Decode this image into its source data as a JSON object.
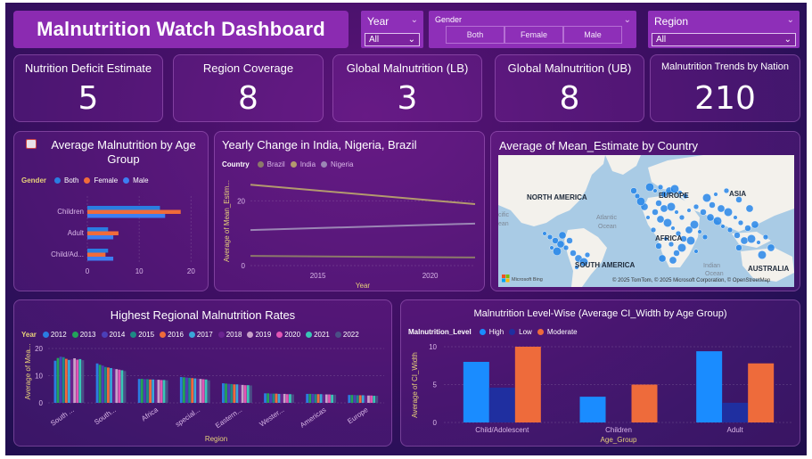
{
  "header": {
    "title": "Malnutrition Watch Dashboard"
  },
  "slicers": {
    "year": {
      "label": "Year",
      "value": "All"
    },
    "gender": {
      "label": "Gender",
      "options": [
        "Both",
        "Female",
        "Male"
      ]
    },
    "region": {
      "label": "Region",
      "value": "All"
    }
  },
  "kpis": [
    {
      "title": "Nutrition Deficit Estimate",
      "value": "5"
    },
    {
      "title": "Region Coverage",
      "value": "8"
    },
    {
      "title": "Global Malnutrition (LB)",
      "value": "3"
    },
    {
      "title": "Global Malnutrition (UB)",
      "value": "8"
    },
    {
      "title": "Malnutrition Trends by Nation",
      "value": "210"
    }
  ],
  "colors": {
    "both": "#2a7de1",
    "female": "#f06b3a",
    "male": "#3d7ef2",
    "high": "#1a8cff",
    "low": "#1f2fa0",
    "moderate": "#ee6b3b",
    "brazil": "#8c7a6a",
    "india": "#b39a6e",
    "nigeria": "#9b86b5"
  },
  "age_chart": {
    "icon": "chart-emoji-icon",
    "title": "Average Malnutrition by Age Group",
    "legend_title": "Gender",
    "legend": [
      "Both",
      "Female",
      "Male"
    ],
    "chart_data": {
      "type": "bar",
      "orientation": "horizontal",
      "categories": [
        "Children",
        "Adult",
        "Child/Ad..."
      ],
      "series": [
        {
          "name": "Both",
          "values": [
            14,
            4,
            4
          ]
        },
        {
          "name": "Female",
          "values": [
            18,
            6,
            3.5
          ]
        },
        {
          "name": "Male",
          "values": [
            15,
            5,
            5
          ]
        }
      ],
      "x_ticks": [
        "0",
        "10",
        "20"
      ],
      "xlim": [
        0,
        22
      ],
      "legend_placement": "top-left"
    }
  },
  "yearly_chart": {
    "title": "Yearly Change in India, Nigeria, Brazil",
    "legend_title": "Country",
    "legend": [
      "Brazil",
      "India",
      "Nigeria"
    ],
    "chart_data": {
      "type": "line",
      "x": [
        2012,
        2022
      ],
      "series": [
        {
          "name": "India",
          "values": [
            25,
            19
          ]
        },
        {
          "name": "Nigeria",
          "values": [
            11,
            13
          ]
        },
        {
          "name": "Brazil",
          "values": [
            3,
            2.5
          ]
        }
      ],
      "x_ticks": [
        "2015",
        "2020"
      ],
      "y_ticks": [
        "0",
        "20"
      ],
      "ylim": [
        0,
        27
      ],
      "xlim": [
        2012,
        2022
      ],
      "xlabel": "Year",
      "ylabel": "Average of Mean_Estim..."
    }
  },
  "map_chart": {
    "title": "Average of Mean_Estimate by Country",
    "labels": {
      "north_america": "NORTH AMERICA",
      "south_america": "SOUTH AMERICA",
      "europe": "EUROPE",
      "asia": "ASIA",
      "africa": "AFRICA",
      "australia": "AUSTRALIA",
      "atlantic": "Atlantic",
      "ocean1": "Ocean",
      "indian": "Indian",
      "ocean2": "Ocean",
      "pacific": "cific",
      "ocean3": "ean"
    },
    "logo": "Microsoft Bing",
    "credit": "© 2025 TomTom, © 2025 Microsoft Corporation, © OpenStreetMap"
  },
  "regional_chart": {
    "title": "Highest Regional Malnutrition Rates",
    "legend_title": "Year",
    "legend": [
      "2012",
      "2013",
      "2014",
      "2015",
      "2016",
      "2017",
      "2018",
      "2019",
      "2020",
      "2021",
      "2022"
    ],
    "legend_colors": [
      "#2a7de1",
      "#22a35a",
      "#4b3fb8",
      "#1d8a84",
      "#f06b3a",
      "#3aa6d8",
      "#6a2390",
      "#c7a0c9",
      "#e255b4",
      "#39c6b6",
      "#4a4f86"
    ],
    "chart_data": {
      "type": "bar",
      "categories": [
        "South ...",
        "South...",
        "Africa",
        "special...",
        "Eastern...",
        "Wester...",
        "Americas",
        "Europe"
      ],
      "series_note": "Each category shows grouped bars per year",
      "values": [
        [
          15.5,
          16.5,
          17,
          16.8,
          16.2,
          15.8,
          16,
          16.4,
          15.9,
          16.1,
          15.7
        ],
        [
          14.5,
          14,
          13.7,
          13.2,
          13,
          12.8,
          12.6,
          12.4,
          12.2,
          12,
          11.7
        ],
        [
          8.8,
          8.8,
          8.7,
          8.7,
          8.6,
          8.6,
          8.5,
          8.5,
          8.4,
          8.4,
          8.3
        ],
        [
          9.5,
          9.4,
          9.3,
          9.2,
          9.1,
          9.0,
          8.9,
          8.8,
          8.7,
          8.6,
          8.3
        ],
        [
          7.2,
          7.1,
          7.0,
          6.9,
          6.8,
          6.8,
          6.7,
          6.6,
          6.5,
          6.5,
          6.4
        ],
        [
          3.5,
          3.5,
          3.4,
          3.4,
          3.4,
          3.3,
          3.3,
          3.3,
          3.2,
          3.2,
          3.1
        ],
        [
          3.3,
          3.3,
          3.3,
          3.2,
          3.2,
          3.2,
          3.1,
          3.1,
          3.1,
          3.0,
          3.0
        ],
        [
          2.9,
          2.9,
          2.9,
          2.8,
          2.8,
          2.8,
          2.7,
          2.7,
          2.7,
          2.6,
          2.6
        ]
      ],
      "y_ticks": [
        "0",
        "10",
        "20"
      ],
      "ylim": [
        0,
        20
      ],
      "xlabel": "Region",
      "ylabel": "Average of Mea..."
    }
  },
  "level_chart": {
    "title": "Malnutrition Level-Wise (Average CI_Width by Age Group)",
    "legend_title": "Malnutrition_Level",
    "legend": [
      "High",
      "Low",
      "Moderate"
    ],
    "chart_data": {
      "type": "bar",
      "categories": [
        "Child/Adolescent",
        "Children",
        "Adult"
      ],
      "series": [
        {
          "name": "High",
          "values": [
            8,
            3.4,
            9.4
          ]
        },
        {
          "name": "Low",
          "values": [
            4.6,
            null,
            2.6
          ]
        },
        {
          "name": "Moderate",
          "values": [
            10,
            5,
            7.8
          ]
        }
      ],
      "y_ticks": [
        "0",
        "5",
        "10"
      ],
      "ylim": [
        0,
        10
      ],
      "xlabel": "Age_Group",
      "ylabel": "Average of CI_Width"
    }
  }
}
